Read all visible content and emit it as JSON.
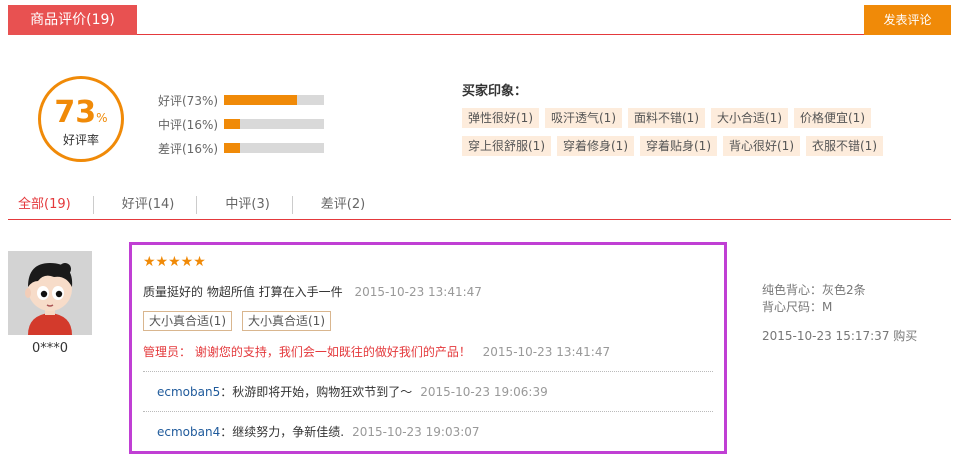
{
  "header": {
    "title": "商品评价(19)",
    "post_button": "发表评论"
  },
  "summary": {
    "rate_value": "73",
    "rate_unit": "%",
    "rate_label": "好评率",
    "bars": [
      {
        "label": "好评(73%)",
        "percent": 73
      },
      {
        "label": "中评(16%)",
        "percent": 16
      },
      {
        "label": "差评(16%)",
        "percent": 16
      }
    ]
  },
  "impression": {
    "title": "买家印象：",
    "tags": [
      "弹性很好(1)",
      "吸汗透气(1)",
      "面料不错(1)",
      "大小合适(1)",
      "价格便宜(1)",
      "穿上很舒服(1)",
      "穿着修身(1)",
      "穿着贴身(1)",
      "背心很好(1)",
      "衣服不错(1)"
    ]
  },
  "filters": [
    "全部(19)",
    "好评(14)",
    "中评(3)",
    "差评(2)"
  ],
  "review": {
    "username": "0***0",
    "stars": "★★★★★",
    "content": "质量挺好的 物超所值 打算在入手一件",
    "time": "2015-10-23 13:41:47",
    "tags": [
      "大小真合适(1)",
      "大小真合适(1)"
    ],
    "admin_reply": "管理员： 谢谢您的支持，我们会一如既往的做好我们的产品！",
    "admin_time": "2015-10-23 13:41:47",
    "replies": [
      {
        "user": "ecmoban5",
        "sep": "：",
        "text": "秋游即将开始，购物狂欢节到了～",
        "time": "2015-10-23 19:06:39"
      },
      {
        "user": "ecmoban4",
        "sep": "：",
        "text": "继续努力，争新佳绩.",
        "time": "2015-10-23 19:03:07"
      }
    ],
    "spec_color": "纯色背心：灰色2条",
    "spec_size": "背心尺码：M",
    "purchase": "2015-10-23 15:17:37 购买"
  },
  "colors": {
    "accent_red": "#e4393c",
    "accent_orange": "#f08a08",
    "highlight_border": "#c03fd4",
    "tag_bg": "#fdecdc"
  }
}
